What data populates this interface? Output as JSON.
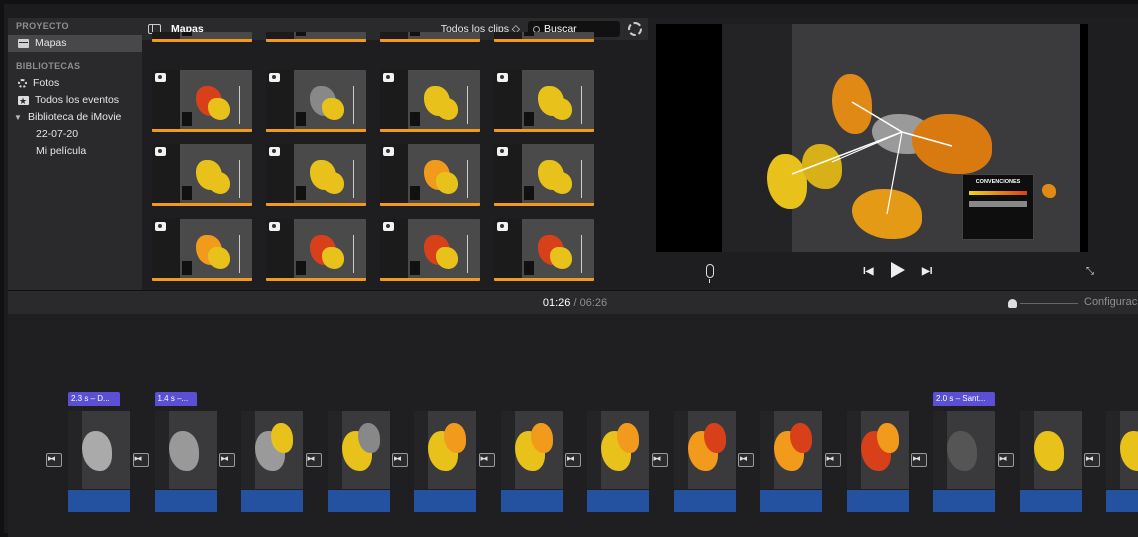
{
  "sidebar": {
    "project_header": "PROYECTO",
    "project_item": "Mapas",
    "libraries_header": "BIBLIOTECAS",
    "items": [
      {
        "label": "Fotos",
        "icon": "photos-icon"
      },
      {
        "label": "Todos los eventos",
        "icon": "star-icon"
      }
    ],
    "library": "Biblioteca de iMovie",
    "library_children": [
      "22-07-20",
      "Mi película"
    ]
  },
  "browser": {
    "title": "Mapas",
    "filter": "Todos los clips ◇",
    "search_value": "Buscar"
  },
  "viewer": {
    "legend_title": "CONVENCIONES"
  },
  "timeline": {
    "current_time": "01:26",
    "separator": " / ",
    "total_time": "06:26",
    "settings_label": "Configuració",
    "titles": [
      {
        "label": "2.3 s – D...",
        "clip": 0
      },
      {
        "label": "1.4 s –...",
        "clip": 1
      },
      {
        "label": "2.0 s – Sant...",
        "clip": 10
      }
    ]
  },
  "colors": {
    "accent_orange": "#f29a1c",
    "map_yellow": "#e8c21a",
    "map_red": "#d8401a",
    "audio_blue": "#2452a0",
    "title_purple": "#5b4fd6"
  }
}
